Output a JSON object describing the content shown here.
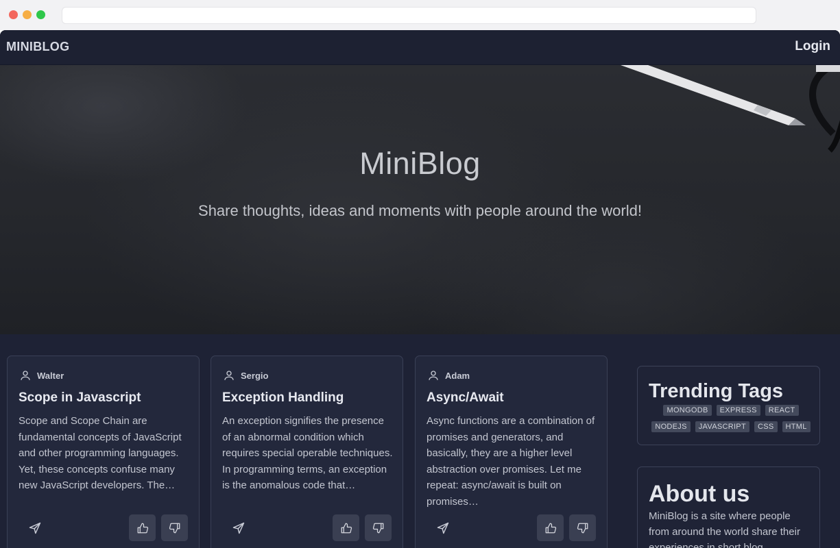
{
  "navbar": {
    "brand": "MINIBLOG",
    "login_label": "Login"
  },
  "hero": {
    "title": "MiniBlog",
    "subtitle": "Share thoughts, ideas and moments with people around the world!"
  },
  "posts": [
    {
      "author": "Walter",
      "title": "Scope in Javascript",
      "excerpt": "Scope and Scope Chain are fundamental concepts of JavaScript and other programming languages. Yet, these concepts confuse many new JavaScript developers. The…"
    },
    {
      "author": "Sergio",
      "title": "Exception Handling",
      "excerpt": "An exception signifies the presence of an abnormal condition which requires special operable techniques. In programming terms, an exception is the anomalous code that…"
    },
    {
      "author": "Adam",
      "title": "Async/Await",
      "excerpt": "Async functions are a combination of promises and generators, and basically, they are a higher level abstraction over promises. Let me repeat: async/await is built on promises…"
    }
  ],
  "sidebar": {
    "trending_title": "Trending Tags",
    "tags": [
      "MONGODB",
      "EXPRESS",
      "REACT",
      "NODEJS",
      "JAVASCRIPT",
      "CSS",
      "HTML"
    ],
    "about_title": "About us",
    "about_text": "MiniBlog is a site where people from around the world share their experiences in short blog"
  },
  "icons": {
    "user": "user-icon",
    "share": "send-icon",
    "like": "thumbs-up-icon",
    "dislike": "thumbs-down-icon"
  }
}
